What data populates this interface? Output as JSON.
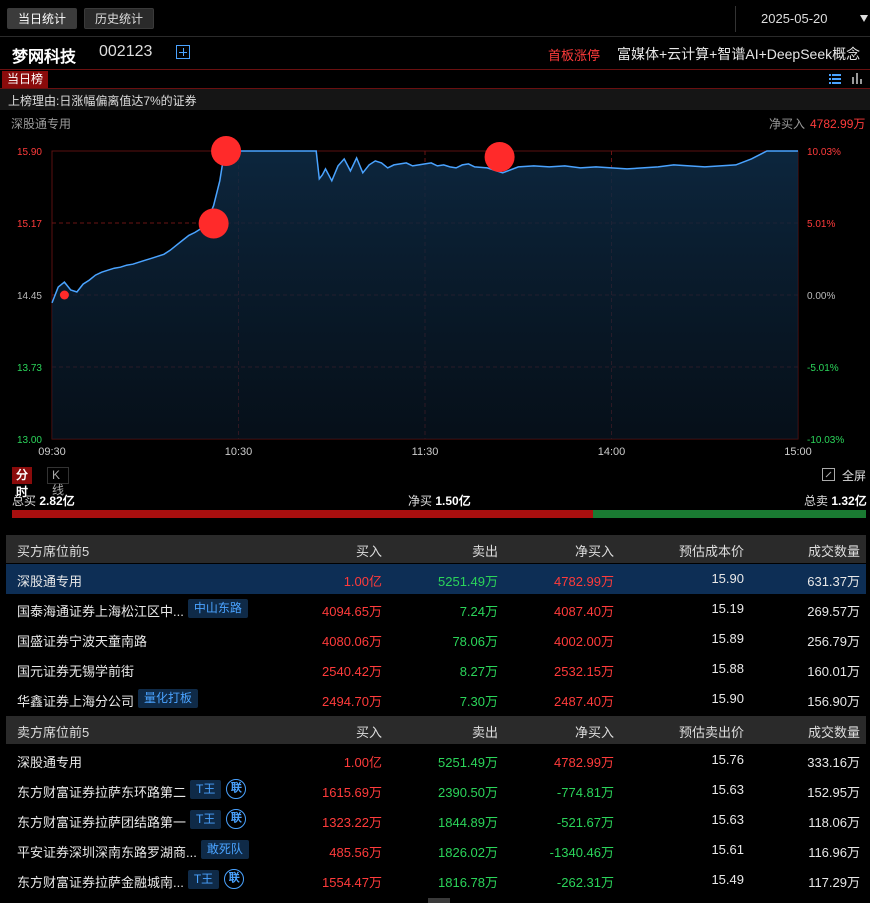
{
  "tabs": [
    {
      "label": "当日统计"
    },
    {
      "label": "历史统计"
    }
  ],
  "date": "2025-05-20",
  "stock": {
    "name": "梦网科技",
    "code": "002123",
    "limit_tag": "首板涨停",
    "concepts": "富媒体+云计算+智谱AI+DeepSeek概念"
  },
  "rank_label": "当日榜",
  "reason": "上榜理由:日涨幅偏离值达7%的证券",
  "chart_header": {
    "title": "深股通专用",
    "net_label": "净买入",
    "net_value": "4782.99万"
  },
  "chart_data": {
    "type": "line",
    "x_ticks": [
      "09:30",
      "10:30",
      "11:30",
      "14:00",
      "15:00"
    ],
    "y_ticks_left": [
      "15.90",
      "15.17",
      "14.45",
      "13.73",
      "13.00"
    ],
    "y_ticks_right": [
      "10.03%",
      "5.01%",
      "0.00%",
      "-5.01%",
      "-10.03%"
    ],
    "ylim": [
      13.0,
      15.9
    ],
    "prev_close": 14.45,
    "series": [
      {
        "minutes": [
          0,
          2,
          4,
          6,
          8,
          10,
          12,
          14,
          16,
          18,
          20,
          22,
          24,
          26,
          28,
          30,
          32,
          34,
          36,
          38,
          40,
          42,
          44,
          46,
          48,
          50,
          52,
          54,
          55,
          56,
          57,
          58,
          59,
          60,
          70,
          80,
          85,
          86,
          87,
          88,
          90,
          92,
          94,
          96,
          98,
          100,
          102,
          104,
          106,
          108,
          110,
          112,
          114,
          116,
          118,
          120,
          122,
          124,
          126,
          128,
          130,
          132,
          134,
          136,
          140,
          145,
          150,
          155,
          160,
          165,
          170,
          175,
          180,
          185,
          190,
          195,
          200,
          205,
          210,
          215,
          220,
          225,
          230,
          240
        ],
        "values": [
          14.37,
          14.53,
          14.58,
          14.5,
          14.48,
          14.56,
          14.6,
          14.65,
          14.68,
          14.7,
          14.72,
          14.73,
          14.75,
          14.76,
          14.78,
          14.8,
          14.82,
          14.84,
          14.86,
          14.9,
          14.95,
          15.0,
          15.05,
          15.08,
          15.12,
          15.2,
          15.35,
          15.6,
          15.8,
          15.9,
          15.9,
          15.9,
          15.9,
          15.9,
          15.9,
          15.9,
          15.9,
          15.62,
          15.66,
          15.72,
          15.6,
          15.75,
          15.82,
          15.7,
          15.83,
          15.68,
          15.76,
          15.8,
          15.78,
          15.73,
          15.76,
          15.77,
          15.78,
          15.75,
          15.76,
          15.77,
          15.78,
          15.75,
          15.76,
          15.74,
          15.73,
          15.76,
          15.77,
          15.74,
          15.73,
          15.68,
          15.74,
          15.75,
          15.74,
          15.75,
          15.73,
          15.74,
          15.73,
          15.72,
          15.73,
          15.74,
          15.76,
          15.75,
          15.74,
          15.75,
          15.76,
          15.82,
          15.9,
          15.9
        ]
      }
    ],
    "markers": [
      {
        "minute": 4,
        "value": 14.45,
        "kind": "small"
      },
      {
        "minute": 52,
        "value": 15.17,
        "kind": "large"
      },
      {
        "minute": 56,
        "value": 15.9,
        "kind": "large"
      },
      {
        "minute": 144,
        "value": 15.84,
        "kind": "large"
      }
    ]
  },
  "chart_tabs": {
    "active": "分时",
    "other": "K线"
  },
  "fullscreen_label": "全屏",
  "summary": {
    "buy_label": "总买",
    "buy_value": "2.82亿",
    "net_label": "净买",
    "net_value": "1.50亿",
    "sell_label": "总卖",
    "sell_value": "1.32亿",
    "buy_ratio": 0.68
  },
  "buy_table": {
    "headers": [
      "买方席位前5",
      "买入",
      "卖出",
      "净买入",
      "预估成本价",
      "成交数量"
    ],
    "rows": [
      {
        "name": "深股通专用",
        "buy": "1.00亿",
        "sell": "5251.49万",
        "net": "4782.99万",
        "price": "15.90",
        "volume": "631.37万",
        "badge": "",
        "lian": ""
      },
      {
        "name": "国泰海通证券上海松江区中...",
        "buy": "4094.65万",
        "sell": "7.24万",
        "net": "4087.40万",
        "price": "15.19",
        "volume": "269.57万",
        "badge": "中山东路",
        "lian": ""
      },
      {
        "name": "国盛证券宁波天童南路",
        "buy": "4080.06万",
        "sell": "78.06万",
        "net": "4002.00万",
        "price": "15.89",
        "volume": "256.79万",
        "badge": "",
        "lian": ""
      },
      {
        "name": "国元证券无锡学前街",
        "buy": "2540.42万",
        "sell": "8.27万",
        "net": "2532.15万",
        "price": "15.88",
        "volume": "160.01万",
        "badge": "",
        "lian": ""
      },
      {
        "name": "华鑫证券上海分公司",
        "buy": "2494.70万",
        "sell": "7.30万",
        "net": "2487.40万",
        "price": "15.90",
        "volume": "156.90万",
        "badge": "量化打板",
        "lian": ""
      }
    ]
  },
  "sell_table": {
    "headers": [
      "卖方席位前5",
      "买入",
      "卖出",
      "净买入",
      "预估卖出价",
      "成交数量"
    ],
    "rows": [
      {
        "name": "深股通专用",
        "buy": "1.00亿",
        "sell": "5251.49万",
        "net": "4782.99万",
        "price": "15.76",
        "volume": "333.16万",
        "badge": "",
        "lian": ""
      },
      {
        "name": "东方财富证券拉萨东环路第二",
        "buy": "1615.69万",
        "sell": "2390.50万",
        "net": "-774.81万",
        "price": "15.63",
        "volume": "152.95万",
        "badge": "T王",
        "lian": "联"
      },
      {
        "name": "东方财富证券拉萨团结路第一",
        "buy": "1323.22万",
        "sell": "1844.89万",
        "net": "-521.67万",
        "price": "15.63",
        "volume": "118.06万",
        "badge": "T王",
        "lian": "联"
      },
      {
        "name": "平安证券深圳深南东路罗湖商...",
        "buy": "485.56万",
        "sell": "1826.02万",
        "net": "-1340.46万",
        "price": "15.61",
        "volume": "116.96万",
        "badge": "敢死队",
        "lian": ""
      },
      {
        "name": "东方财富证券拉萨金融城南...",
        "buy": "1554.47万",
        "sell": "1816.78万",
        "net": "-262.31万",
        "price": "15.49",
        "volume": "117.29万",
        "badge": "T王",
        "lian": "联"
      }
    ]
  },
  "colors": {
    "up": "#ff3b3b",
    "down": "#2bd45a",
    "line": "#4aa3ff",
    "accent": "#8a0b0b"
  }
}
